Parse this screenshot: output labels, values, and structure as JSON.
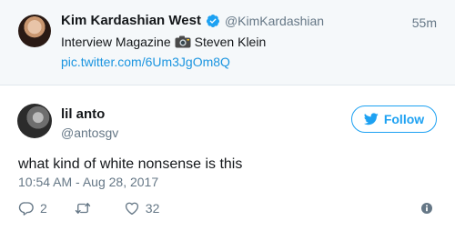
{
  "quoted": {
    "name": "Kim Kardashian West",
    "handle": "@KimKardashian",
    "time": "55m",
    "text_before": "Interview Magazine",
    "text_after": "Steven Klein",
    "link": "pic.twitter.com/6Um3JgOm8Q",
    "icons": [
      "verified-badge-icon",
      "camera-emoji-icon"
    ]
  },
  "tweet": {
    "name": "lil anto",
    "handle": "@antosgv",
    "follow_label": "Follow",
    "text": "what kind of white nonsense is this",
    "date": "10:54 AM - Aug 28, 2017"
  },
  "actions": {
    "replies": "2",
    "retweets": "",
    "likes": "32",
    "icons": [
      "reply-icon",
      "retweet-icon",
      "like-icon",
      "info-icon"
    ]
  },
  "colors": {
    "accent": "#1da1f2",
    "link": "#1b95e0",
    "muted": "#657786",
    "text": "#14171a",
    "quoted_bg": "#f5f8fa"
  }
}
